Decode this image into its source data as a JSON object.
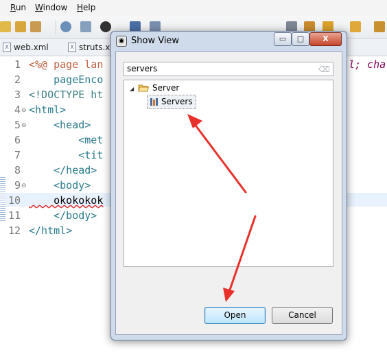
{
  "menubar": {
    "items": [
      "Run",
      "Window",
      "Help"
    ]
  },
  "tabs": [
    {
      "label": "web.xml"
    },
    {
      "label": "struts.xml"
    }
  ],
  "editor": {
    "lines": [
      {
        "num": "1",
        "text": "<%@ page lan"
      },
      {
        "num": "2",
        "text": "    pageEnco"
      },
      {
        "num": "3",
        "text": "<!DOCTYPE ht"
      },
      {
        "num": "4",
        "text": "<html>"
      },
      {
        "num": "5",
        "text": "    <head>"
      },
      {
        "num": "6",
        "text": "        <met"
      },
      {
        "num": "7",
        "text": "        <tit"
      },
      {
        "num": "8",
        "text": "    </head>"
      },
      {
        "num": "9",
        "text": "    <body>"
      },
      {
        "num": "10",
        "text": "    okokokok"
      },
      {
        "num": "11",
        "text": "    </body>"
      },
      {
        "num": "12",
        "text": "</html>"
      }
    ],
    "overflow_text": "l; cha"
  },
  "dialog": {
    "title": "Show View",
    "filter_value": "servers",
    "tree": {
      "category": "Server",
      "item": "Servers"
    },
    "buttons": {
      "minimize": "▭",
      "maximize": "□",
      "close": "X",
      "open": "Open",
      "cancel": "Cancel"
    }
  },
  "colors": {
    "annotation_arrow": "#e8312a",
    "dialog_frame": "#cfdbea",
    "current_line": "#e8f2fe"
  }
}
